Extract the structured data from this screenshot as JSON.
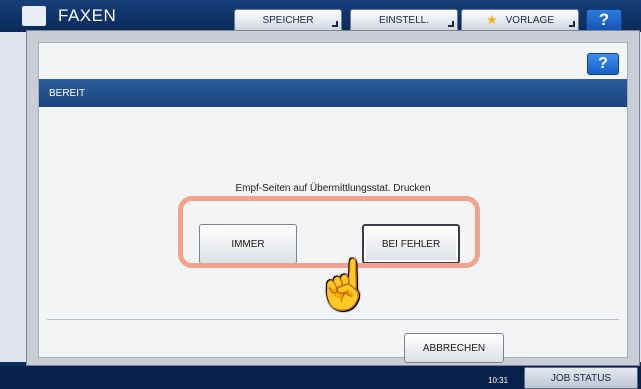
{
  "app": {
    "title": "FAXEN"
  },
  "top_tabs": {
    "speicher": "SPEICHER",
    "einstell": "EINSTELL.",
    "vorlage": "VORLAGE"
  },
  "help": {
    "top_label": "?",
    "dialog_label": "?"
  },
  "dialog": {
    "status": "BEREIT",
    "message": "Empf-Seiten auf Übermittlungsstat. Drucken",
    "options": {
      "immer": "IMMER",
      "bei_fehler": "BEI FEHLER"
    },
    "selected_option": "BEI FEHLER",
    "cancel_label": "ABBRECHEN"
  },
  "footer": {
    "time": "10:31",
    "job_status_label": "JOB STATUS"
  },
  "colors": {
    "highlight": "#f2a28d",
    "status_bar": "#1f4f8c",
    "help_button": "#1660c4"
  },
  "icons": {
    "app": "fax-icon",
    "vorlage": "star-icon",
    "cursor": "hand-pointer-icon"
  }
}
